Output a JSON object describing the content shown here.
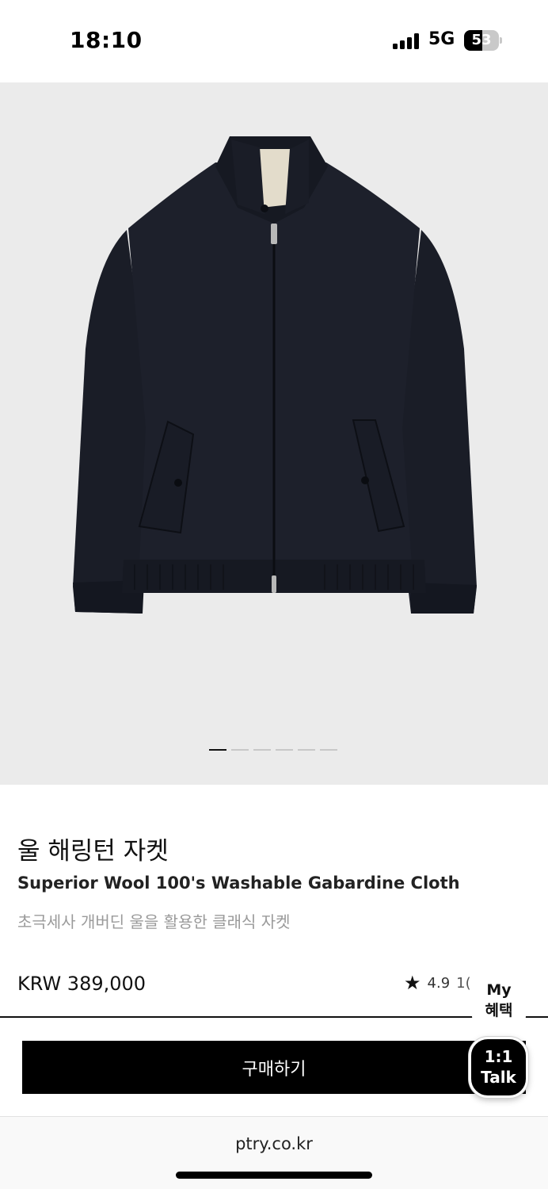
{
  "status_bar": {
    "time": "18:10",
    "network": "5G",
    "battery": "53",
    "battery_level_percent": 53,
    "signal_bars": 4
  },
  "gallery": {
    "image_icon": "jacket-product-image",
    "slide_count": 6,
    "active_slide": 1
  },
  "product": {
    "name": "울 해링턴 자켓",
    "subtitle": "Superior Wool 100's Washable Gabardine Cloth",
    "description": "초극세사 개버딘 울을 활용한 클래식 자켓",
    "price": "KRW 389,000",
    "rating": "4.9",
    "review_count_partial": "1("
  },
  "floating": {
    "my_benefit_line1": "My",
    "my_benefit_line2": "혜택",
    "talk_line1": "1:1",
    "talk_line2": "Talk"
  },
  "actions": {
    "buy_label": "구매하기"
  },
  "browser": {
    "url": "ptry.co.kr"
  },
  "colors": {
    "image_background": "#ebebeb",
    "jacket": "#1c1f2a",
    "button": "#000000",
    "muted_text": "#9a9a9a"
  }
}
